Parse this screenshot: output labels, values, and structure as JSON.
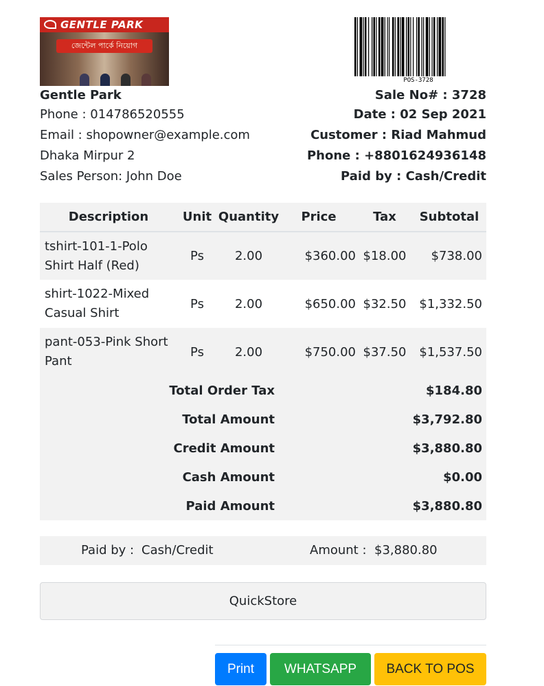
{
  "shop": {
    "logo_text": "GENTLE PARK",
    "logo_banner": "জেন্টেল পার্কে নিয়োগ",
    "name": "Gentle Park",
    "phone": "Phone : 014786520555",
    "email": "Email : shopowner@example.com",
    "address": "Dhaka Mirpur 2",
    "sales_person": "Sales Person: John Doe"
  },
  "barcode": {
    "code": "POS-3728"
  },
  "sale": {
    "sale_no": "Sale No# : 3728",
    "date": "Date : 02 Sep 2021",
    "customer": "Customer : Riad Mahmud",
    "phone": "Phone : +8801624936148",
    "paid_by": "Paid by : Cash/Credit"
  },
  "table": {
    "headers": [
      "Description",
      "Unit",
      "Quantity",
      "Price",
      "Tax",
      "Subtotal"
    ],
    "rows": [
      {
        "description": "tshirt-101-1-Polo Shirt Half (Red)",
        "unit": "Ps",
        "quantity": "2.00",
        "price": "$360.00",
        "tax": "$18.00",
        "subtotal": "$738.00"
      },
      {
        "description": "shirt-1022-Mixed Casual Shirt",
        "unit": "Ps",
        "quantity": "2.00",
        "price": "$650.00",
        "tax": "$32.50",
        "subtotal": "$1,332.50"
      },
      {
        "description": "pant-053-Pink Short Pant",
        "unit": "Ps",
        "quantity": "2.00",
        "price": "$750.00",
        "tax": "$37.50",
        "subtotal": "$1,537.50"
      }
    ],
    "totals": [
      {
        "label": "Total Order Tax",
        "value": "$184.80"
      },
      {
        "label": "Total Amount",
        "value": "$3,792.80"
      },
      {
        "label": "Credit Amount",
        "value": "$3,880.80"
      },
      {
        "label": "Cash Amount",
        "value": "$0.00"
      },
      {
        "label": "Paid Amount",
        "value": "$3,880.80"
      }
    ]
  },
  "payment": {
    "paid_by_label": "Paid by :",
    "paid_by_value": "Cash/Credit",
    "amount_label": "Amount :",
    "amount_value": "$3,880.80"
  },
  "footer": {
    "store_name": "QuickStore"
  },
  "buttons": {
    "print": "Print",
    "whatsapp": "WHATSAPP",
    "back": "BACK TO POS"
  },
  "colors": {
    "print": "#007bff",
    "whatsapp": "#28a745",
    "back": "#ffc107",
    "logo_red": "#c8261e"
  }
}
